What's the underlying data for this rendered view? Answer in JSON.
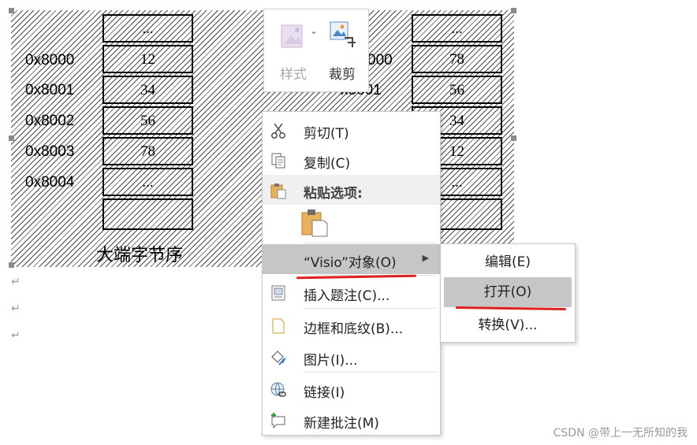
{
  "diagram": {
    "left_cells": [
      "...",
      "12",
      "34",
      "56",
      "78",
      "...",
      ""
    ],
    "left_addresses": [
      "0x8000",
      "0x8001",
      "0x8002",
      "0x8003",
      "0x8004"
    ],
    "right_cells": [
      "...",
      "78",
      "56",
      "34",
      "12",
      "...",
      ""
    ],
    "right_addresses": [
      "000",
      "x8001"
    ],
    "caption": "大端字节序"
  },
  "ribbon": {
    "style_label": "样式",
    "crop_label": "裁剪",
    "dropdown_glyph": "⌄"
  },
  "menu": {
    "items": [
      {
        "label": "剪切(T)",
        "icon": "scissors-icon"
      },
      {
        "label": "复制(C)",
        "icon": "copy-icon"
      },
      {
        "label": "粘贴选项:",
        "icon": "clipboard-icon"
      },
      {
        "label": "“Visio”对象(O)",
        "icon": ""
      },
      {
        "label": "插入题注(C)...",
        "icon": "caption-icon"
      },
      {
        "label": "边框和底纹(B)...",
        "icon": "page-icon"
      },
      {
        "label": "图片(I)...",
        "icon": "paint-bucket-icon"
      },
      {
        "label": "链接(I)",
        "icon": "link-icon"
      },
      {
        "label": "新建批注(M)",
        "icon": "comment-icon"
      }
    ],
    "arrow": "▶"
  },
  "submenu": {
    "items": [
      "编辑(E)",
      "打开(O)",
      "转换(V)..."
    ]
  },
  "watermark": "CSDN @带上一无所知的我",
  "return_glyph": "↵",
  "colors": {
    "highlight": "#c6c6c6",
    "annotation_red": "#e02020"
  }
}
